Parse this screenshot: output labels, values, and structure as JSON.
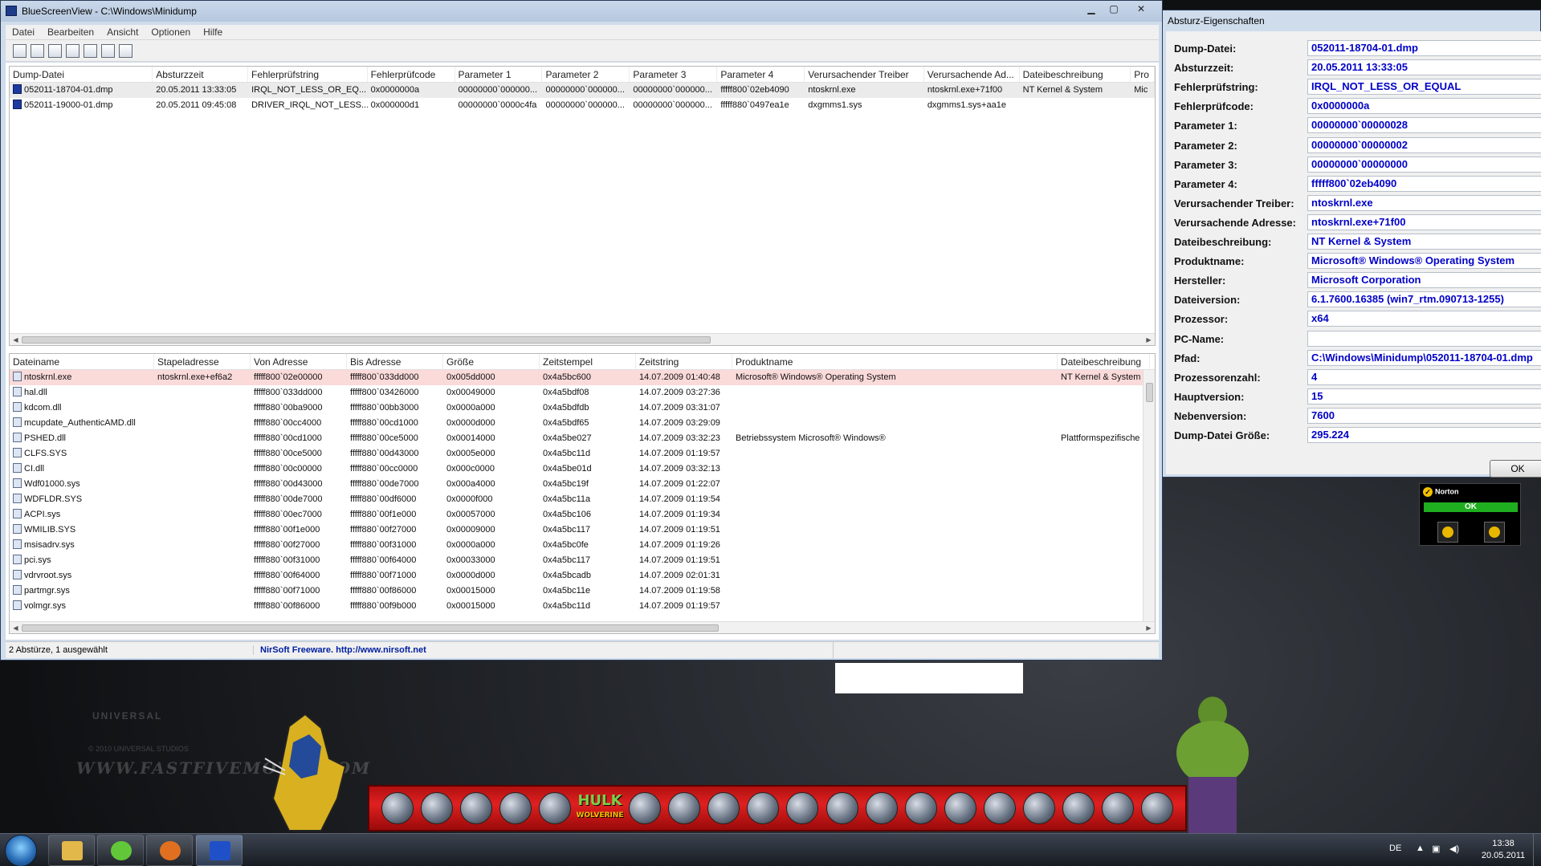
{
  "main_window": {
    "title": "BlueScreenView  -  C:\\Windows\\Minidump",
    "menu": [
      "Datei",
      "Bearbeiten",
      "Ansicht",
      "Optionen",
      "Hilfe"
    ],
    "crash_table": {
      "columns": [
        "Dump-Datei",
        "Absturzzeit",
        "Fehlerprüfstring",
        "Fehlerprüfcode",
        "Parameter 1",
        "Parameter 2",
        "Parameter 3",
        "Parameter 4",
        "Verursachender Treiber",
        "Verursachende Ad...",
        "Dateibeschreibung",
        "Pro"
      ],
      "rows": [
        [
          "052011-18704-01.dmp",
          "20.05.2011 13:33:05",
          "IRQL_NOT_LESS_OR_EQ...",
          "0x0000000a",
          "00000000`000000...",
          "00000000`000000...",
          "00000000`000000...",
          "fffff800`02eb4090",
          "ntoskrnl.exe",
          "ntoskrnl.exe+71f00",
          "NT Kernel & System",
          "Mic"
        ],
        [
          "052011-19000-01.dmp",
          "20.05.2011 09:45:08",
          "DRIVER_IRQL_NOT_LESS...",
          "0x000000d1",
          "00000000`0000c4fa",
          "00000000`000000...",
          "00000000`000000...",
          "fffff880`0497ea1e",
          "dxgmms1.sys",
          "dxgmms1.sys+aa1e",
          "",
          ""
        ]
      ]
    },
    "driver_table": {
      "columns": [
        "Dateiname",
        "Stapeladresse",
        "Von Adresse",
        "Bis Adresse",
        "Größe",
        "Zeitstempel",
        "Zeitstring",
        "Produktname",
        "Dateibeschreibung"
      ],
      "rows": [
        [
          "ntoskrnl.exe",
          "ntoskrnl.exe+ef6a2",
          "fffff800`02e00000",
          "fffff800`033dd000",
          "0x005dd000",
          "0x4a5bc600",
          "14.07.2009 01:40:48",
          "Microsoft® Windows® Operating System",
          "NT Kernel & System"
        ],
        [
          "hal.dll",
          "",
          "fffff800`033dd000",
          "fffff800`03426000",
          "0x00049000",
          "0x4a5bdf08",
          "14.07.2009 03:27:36",
          "",
          ""
        ],
        [
          "kdcom.dll",
          "",
          "fffff880`00ba9000",
          "fffff880`00bb3000",
          "0x0000a000",
          "0x4a5bdfdb",
          "14.07.2009 03:31:07",
          "",
          ""
        ],
        [
          "mcupdate_AuthenticAMD.dll",
          "",
          "fffff880`00cc4000",
          "fffff880`00cd1000",
          "0x0000d000",
          "0x4a5bdf65",
          "14.07.2009 03:29:09",
          "",
          ""
        ],
        [
          "PSHED.dll",
          "",
          "fffff880`00cd1000",
          "fffff880`00ce5000",
          "0x00014000",
          "0x4a5be027",
          "14.07.2009 03:32:23",
          "Betriebssystem Microsoft® Windows®",
          "Plattformspezifische"
        ],
        [
          "CLFS.SYS",
          "",
          "fffff880`00ce5000",
          "fffff880`00d43000",
          "0x0005e000",
          "0x4a5bc11d",
          "14.07.2009 01:19:57",
          "",
          ""
        ],
        [
          "CI.dll",
          "",
          "fffff880`00c00000",
          "fffff880`00cc0000",
          "0x000c0000",
          "0x4a5be01d",
          "14.07.2009 03:32:13",
          "",
          ""
        ],
        [
          "Wdf01000.sys",
          "",
          "fffff880`00d43000",
          "fffff880`00de7000",
          "0x000a4000",
          "0x4a5bc19f",
          "14.07.2009 01:22:07",
          "",
          ""
        ],
        [
          "WDFLDR.SYS",
          "",
          "fffff880`00de7000",
          "fffff880`00df6000",
          "0x0000f000",
          "0x4a5bc11a",
          "14.07.2009 01:19:54",
          "",
          ""
        ],
        [
          "ACPI.sys",
          "",
          "fffff880`00ec7000",
          "fffff880`00f1e000",
          "0x00057000",
          "0x4a5bc106",
          "14.07.2009 01:19:34",
          "",
          ""
        ],
        [
          "WMILIB.SYS",
          "",
          "fffff880`00f1e000",
          "fffff880`00f27000",
          "0x00009000",
          "0x4a5bc117",
          "14.07.2009 01:19:51",
          "",
          ""
        ],
        [
          "msisadrv.sys",
          "",
          "fffff880`00f27000",
          "fffff880`00f31000",
          "0x0000a000",
          "0x4a5bc0fe",
          "14.07.2009 01:19:26",
          "",
          ""
        ],
        [
          "pci.sys",
          "",
          "fffff880`00f31000",
          "fffff880`00f64000",
          "0x00033000",
          "0x4a5bc117",
          "14.07.2009 01:19:51",
          "",
          ""
        ],
        [
          "vdrvroot.sys",
          "",
          "fffff880`00f64000",
          "fffff880`00f71000",
          "0x0000d000",
          "0x4a5bcadb",
          "14.07.2009 02:01:31",
          "",
          ""
        ],
        [
          "partmgr.sys",
          "",
          "fffff880`00f71000",
          "fffff880`00f86000",
          "0x00015000",
          "0x4a5bc11e",
          "14.07.2009 01:19:58",
          "",
          ""
        ],
        [
          "volmgr.sys",
          "",
          "fffff880`00f86000",
          "fffff880`00f9b000",
          "0x00015000",
          "0x4a5bc11d",
          "14.07.2009 01:19:57",
          "",
          ""
        ]
      ]
    },
    "status_left": "2 Abstürze, 1 ausgewählt",
    "status_link": "NirSoft Freeware.  http://www.nirsoft.net"
  },
  "properties": {
    "title": "Absturz-Eigenschaften",
    "rows": [
      {
        "label": "Dump-Datei:",
        "value": "052011-18704-01.dmp"
      },
      {
        "label": "Absturzzeit:",
        "value": "20.05.2011 13:33:05"
      },
      {
        "label": "Fehlerprüfstring:",
        "value": "IRQL_NOT_LESS_OR_EQUAL"
      },
      {
        "label": "Fehlerprüfcode:",
        "value": "0x0000000a"
      },
      {
        "label": "Parameter 1:",
        "value": "00000000`00000028"
      },
      {
        "label": "Parameter 2:",
        "value": "00000000`00000002"
      },
      {
        "label": "Parameter 3:",
        "value": "00000000`00000000"
      },
      {
        "label": "Parameter 4:",
        "value": "fffff800`02eb4090"
      },
      {
        "label": "Verursachender Treiber:",
        "value": "ntoskrnl.exe"
      },
      {
        "label": "Verursachende Adresse:",
        "value": "ntoskrnl.exe+71f00"
      },
      {
        "label": "Dateibeschreibung:",
        "value": "NT Kernel & System"
      },
      {
        "label": "Produktname:",
        "value": "Microsoft® Windows® Operating System"
      },
      {
        "label": "Hersteller:",
        "value": "Microsoft Corporation"
      },
      {
        "label": "Dateiversion:",
        "value": "6.1.7600.16385 (win7_rtm.090713-1255)"
      },
      {
        "label": "Prozessor:",
        "value": "x64"
      },
      {
        "label": "PC-Name:",
        "value": ""
      },
      {
        "label": "Pfad:",
        "value": "C:\\Windows\\Minidump\\052011-18704-01.dmp"
      },
      {
        "label": "Prozessorenzahl:",
        "value": "4"
      },
      {
        "label": "Hauptversion:",
        "value": "15"
      },
      {
        "label": "Nebenversion:",
        "value": "7600"
      },
      {
        "label": "Dump-Datei Größe:",
        "value": "295.224"
      }
    ],
    "ok_label": "OK"
  },
  "desktop": {
    "watermark": "WWW.FASTFIVEMOVIE.COM",
    "universal": "UNIVERSAL",
    "universal_copy": "© 2010 UNIVERSAL STUDIOS",
    "dock_hulk_title": "HULK",
    "dock_hulk_sub": "WOLVERINE"
  },
  "norton": {
    "brand": "Norton",
    "status": "OK"
  },
  "taskbar": {
    "language": "DE",
    "time": "13:38",
    "date": "20.05.2011"
  },
  "colors": {
    "selection_highlight": "#fbdada",
    "value_text": "#0000c8",
    "link_text": "#0020a0"
  },
  "icons": {
    "window_minimize": "minimize-icon",
    "window_maximize": "maximize-icon",
    "window_close": "close-icon",
    "file": "file-icon",
    "dump": "dump-file-icon"
  }
}
